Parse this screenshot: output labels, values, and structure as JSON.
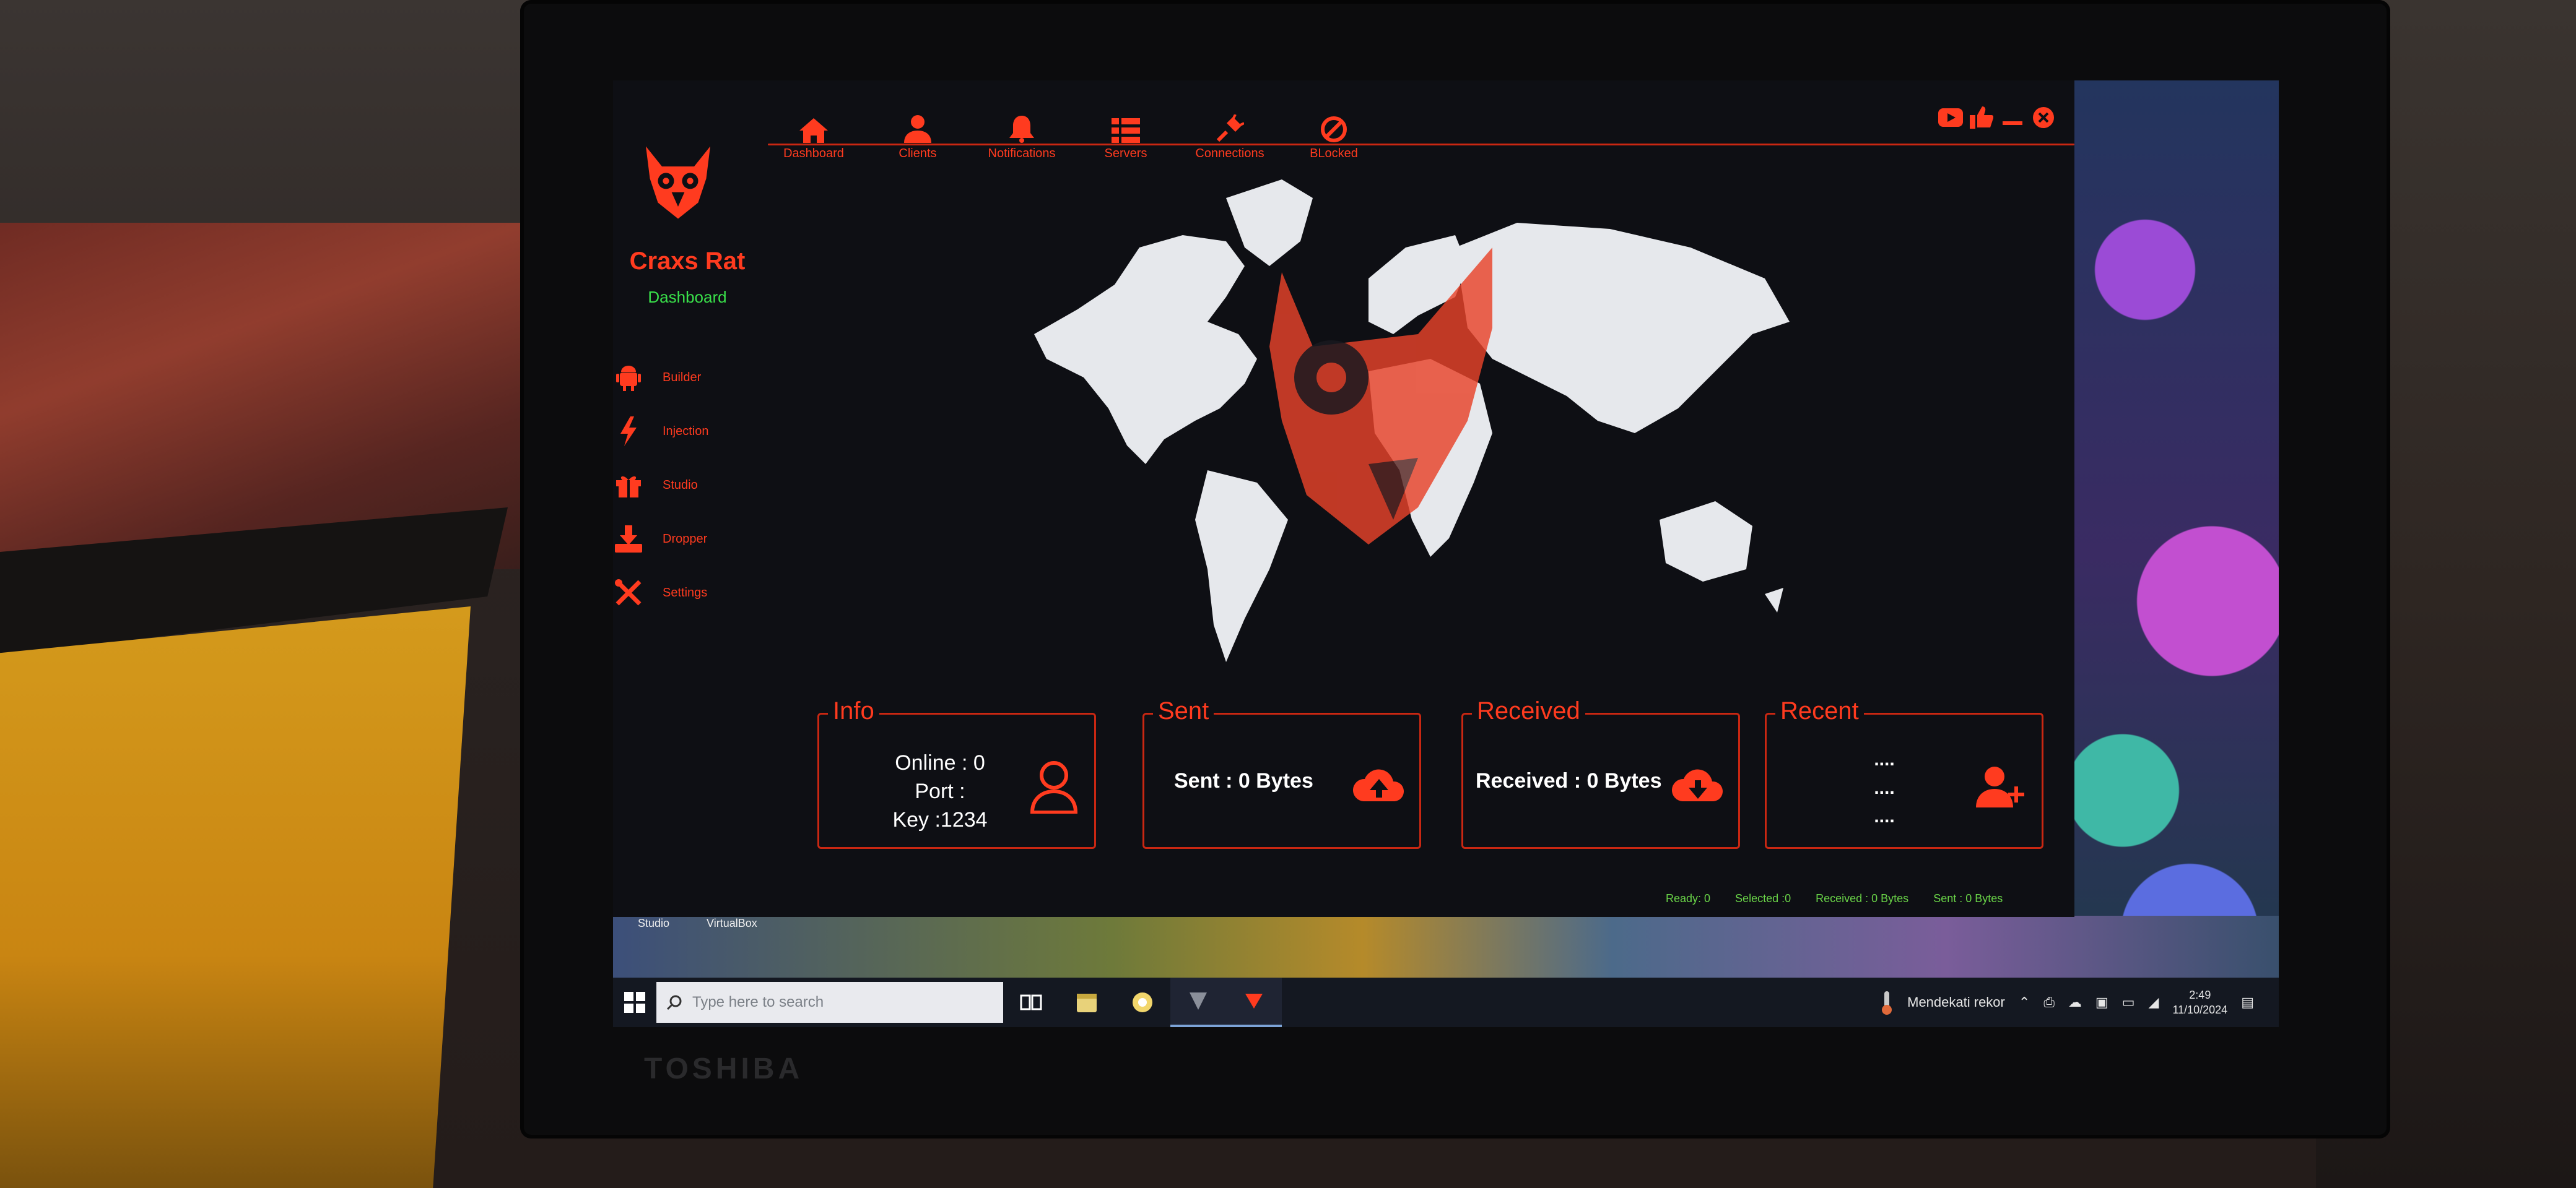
{
  "app": {
    "name": "Craxs Rat",
    "subtitle": "Dashboard",
    "accent_color": "#ff3b1f",
    "status_color": "#39e04a"
  },
  "topnav": [
    {
      "label": "Dashboard",
      "icon": "home-icon"
    },
    {
      "label": "Clients",
      "icon": "user-icon"
    },
    {
      "label": "Notifications",
      "icon": "bell-icon"
    },
    {
      "label": "Servers",
      "icon": "server-list-icon"
    },
    {
      "label": "Connections",
      "icon": "plug-icon"
    },
    {
      "label": "BLocked",
      "icon": "blocked-icon"
    }
  ],
  "window_controls": [
    "youtube-icon",
    "thumbs-up-icon",
    "minimize-icon",
    "close-icon"
  ],
  "sidebar": [
    {
      "label": "Builder",
      "icon": "android-icon"
    },
    {
      "label": "Injection",
      "icon": "lightning-icon"
    },
    {
      "label": "Studio",
      "icon": "gift-icon"
    },
    {
      "label": "Dropper",
      "icon": "download-tray-icon"
    },
    {
      "label": "Settings",
      "icon": "tools-icon"
    }
  ],
  "cards": {
    "info": {
      "title": "Info",
      "online": "Online : 0",
      "port": "Port :",
      "key": "Key :1234",
      "icon": "user-outline-icon"
    },
    "sent": {
      "title": "Sent",
      "text": "Sent : 0 Bytes",
      "icon": "cloud-upload-icon"
    },
    "received": {
      "title": "Received",
      "text": "Received : 0 Bytes",
      "icon": "cloud-download-icon"
    },
    "recent": {
      "title": "Recent",
      "lines": [
        "....",
        "....",
        "...."
      ],
      "icon": "user-add-icon"
    }
  },
  "statusbar": [
    "Ready: 0",
    "Selected :0",
    "Received : 0 Bytes",
    "Sent : 0 Bytes"
  ],
  "desktop_labels": [
    "Studio",
    "VirtualBox"
  ],
  "taskbar": {
    "search_placeholder": "Type here to search",
    "weather": "Mendekati rekor",
    "time": "2:49",
    "date": "11/10/2024"
  },
  "device_brand": "TOSHIBA"
}
